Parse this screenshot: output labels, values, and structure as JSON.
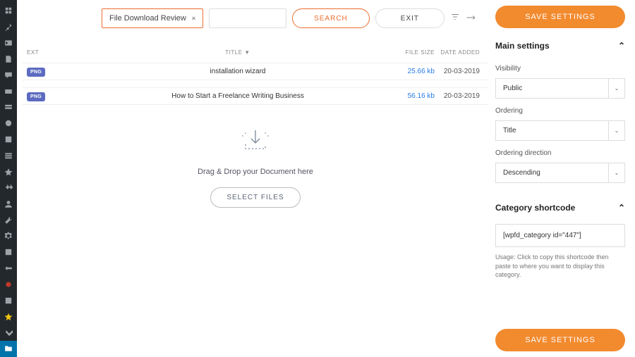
{
  "topbar": {
    "breadcrumb": "File Download Review",
    "breadcrumb_close": "×",
    "search_label": "SEARCH",
    "exit_label": "EXIT",
    "search_placeholder": ""
  },
  "table": {
    "headers": {
      "ext": "EXT",
      "title": "TITLE",
      "size": "FILE SIZE",
      "date": "DATE ADDED"
    },
    "sort_col": "title",
    "rows": [
      {
        "ext": "PNG",
        "title": "installation wizard",
        "size": "25.66 kb",
        "date": "20-03-2019"
      },
      {
        "ext": "PNG",
        "title": "How to Start a Freelance Writing Business",
        "size": "56.16 kb",
        "date": "20-03-2019"
      }
    ]
  },
  "dropzone": {
    "text": "Drag & Drop your Document here",
    "button": "SELECT FILES"
  },
  "right": {
    "save_label": "SAVE SETTINGS",
    "main_title": "Main settings",
    "visibility_label": "Visibility",
    "visibility_value": "Public",
    "ordering_label": "Ordering",
    "ordering_value": "Title",
    "orddir_label": "Ordering direction",
    "orddir_value": "Descending",
    "shortcode_title": "Category shortcode",
    "shortcode_value": "[wpfd_category id=\"447\"]",
    "usage": "Usage: Click to copy this shortcode then paste to where you want to display this category."
  }
}
